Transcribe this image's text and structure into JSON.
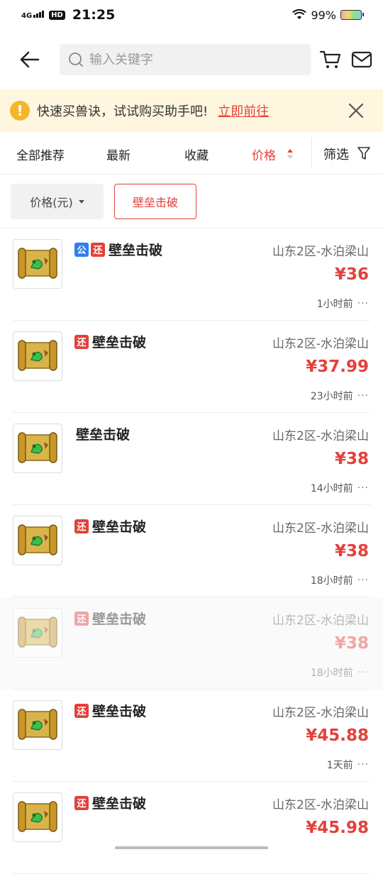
{
  "status_bar": {
    "network": "4G",
    "hd": "HD",
    "time": "21:25",
    "battery": "99%"
  },
  "search": {
    "placeholder": "输入关键字"
  },
  "notice": {
    "text": "快速买兽诀，试试购买助手吧!",
    "link": "立即前往"
  },
  "sort_tabs": [
    {
      "label": "全部推荐"
    },
    {
      "label": "最新"
    },
    {
      "label": "收藏"
    },
    {
      "label": "价格",
      "active": true
    }
  ],
  "filter_label": "筛选",
  "chips": {
    "price": "价格(元)",
    "item": "壁垒击破"
  },
  "colors": {
    "accent": "#e3413b",
    "notice_bg": "#fff6df",
    "tag_blue": "#2f7ff0"
  },
  "items": [
    {
      "tags": [
        "公",
        "还"
      ],
      "title": "壁垒击破",
      "server": "山东2区-水泊梁山",
      "price": "¥36",
      "time": "1小时前"
    },
    {
      "tags": [
        "还"
      ],
      "title": "壁垒击破",
      "server": "山东2区-水泊梁山",
      "price": "¥37.99",
      "time": "23小时前"
    },
    {
      "tags": [],
      "title": "壁垒击破",
      "server": "山东2区-水泊梁山",
      "price": "¥38",
      "time": "14小时前"
    },
    {
      "tags": [
        "还"
      ],
      "title": "壁垒击破",
      "server": "山东2区-水泊梁山",
      "price": "¥38",
      "time": "18小时前"
    },
    {
      "tags": [
        "还"
      ],
      "title": "壁垒击破",
      "server": "山东2区-水泊梁山",
      "price": "¥38",
      "time": "18小时前",
      "dimmed": true
    },
    {
      "tags": [
        "还"
      ],
      "title": "壁垒击破",
      "server": "山东2区-水泊梁山",
      "price": "¥45.88",
      "time": "1天前"
    },
    {
      "tags": [
        "还"
      ],
      "title": "壁垒击破",
      "server": "山东2区-水泊梁山",
      "price": "¥45.98",
      "time": ""
    }
  ]
}
